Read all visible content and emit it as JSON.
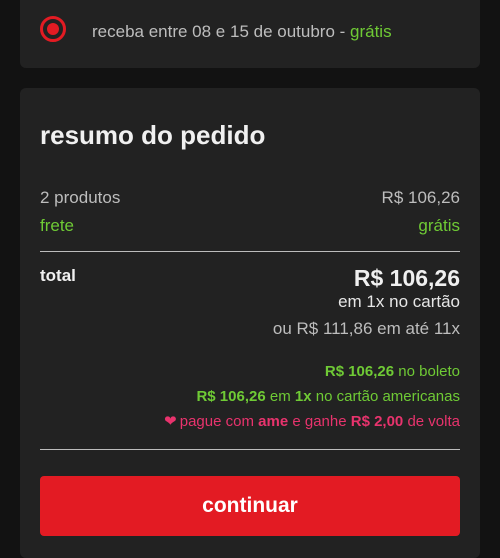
{
  "delivery": {
    "text": "receba entre 08 e 15 de outubro - ",
    "price": "grátis"
  },
  "summary": {
    "title": "resumo do pedido",
    "products_label": "2 produtos",
    "products_value": "R$ 106,26",
    "shipping_label": "frete",
    "shipping_value": "grátis",
    "total_label": "total",
    "total_value": "R$ 106,26",
    "installment": "em 1x no cartão",
    "alt_installment": "ou R$ 111,86 em até 11x",
    "boleto": {
      "amount": "R$ 106,26",
      "text": " no boleto"
    },
    "americanas_card": {
      "amount": "R$ 106,26",
      "mid": " em ",
      "times": "1x",
      "text": " no cartão americanas"
    },
    "ame": {
      "text1": "pague com ",
      "brand": "ame",
      "text2": " e ganhe ",
      "cashback": "R$ 2,00",
      "text3": " de volta"
    },
    "continue_label": "continuar"
  },
  "colors": {
    "accent_red": "#e31b23",
    "green": "#6fca35",
    "pink": "#e8336d",
    "background": "#121212",
    "card": "#222222"
  },
  "icons": {
    "radio": "radio-selected-icon",
    "heart": "heart-icon"
  }
}
